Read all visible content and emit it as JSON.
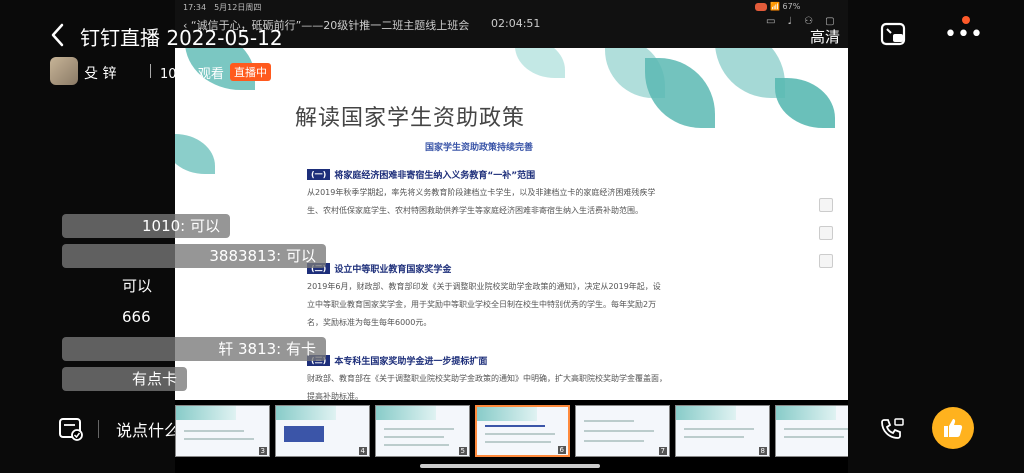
{
  "header": {
    "title": "钉钉直播 2022-05-12",
    "quality": "高清",
    "viewers": "100人观看",
    "live_badge": "直播中",
    "host": "殳 锌"
  },
  "inner": {
    "status_time": "17:34",
    "status_date": "5月12日周四",
    "battery": "67%",
    "title": "“诚信于心，砥砺前行”——20级针推一二班主题线上班会",
    "elapsed": "02:04:51"
  },
  "slide": {
    "title": "解读国家学生资助政策",
    "subtitle": "国家学生资助政策持续完善",
    "sections": [
      {
        "num": "(一)",
        "heading": "将家庭经济困难非寄宿生纳入义务教育“一补”范围",
        "text": "从2019年秋季学期起，率先将义务教育阶段建档立卡学生，以及非建档立卡的家庭经济困难残疾学生、农村低保家庭学生、农村特困救助供养学生等家庭经济困难非寄宿生纳入生活费补助范围。"
      },
      {
        "num": "(二)",
        "heading": "设立中等职业教育国家奖学金",
        "text": "2019年6月，财政部、教育部印发《关于调整职业院校奖助学金政策的通知》，决定从2019年起，设立中等职业教育国家奖学金，用于奖励中等职业学校全日制在校生中特别优秀的学生。每年奖励2万名，奖励标准为每生每年6000元。"
      },
      {
        "num": "(三)",
        "heading": "本专科生国家奖助学金进一步提标扩面",
        "text": "财政部、教育部在《关于调整职业院校奖助学金政策的通知》中明确，扩大高职院校奖助学金覆盖面，提高补助标准。"
      }
    ]
  },
  "comments": [
    {
      "text": "1010: 可以"
    },
    {
      "text": "3883813: 可以"
    },
    {
      "text": "可以"
    },
    {
      "text": "666"
    },
    {
      "text": "轩 3813: 有卡"
    },
    {
      "text": "有点卡"
    }
  ],
  "bottom": {
    "input_placeholder": "说点什么吧",
    "thumb_numbers": [
      "3",
      "4",
      "5",
      "6",
      "7",
      "8",
      "9"
    ]
  },
  "colors": {
    "live_badge": "#ff5a1e",
    "like_button": "#ffb21e",
    "active_thumb": "#ff8a3c",
    "leaf": "#5ab9b3"
  }
}
